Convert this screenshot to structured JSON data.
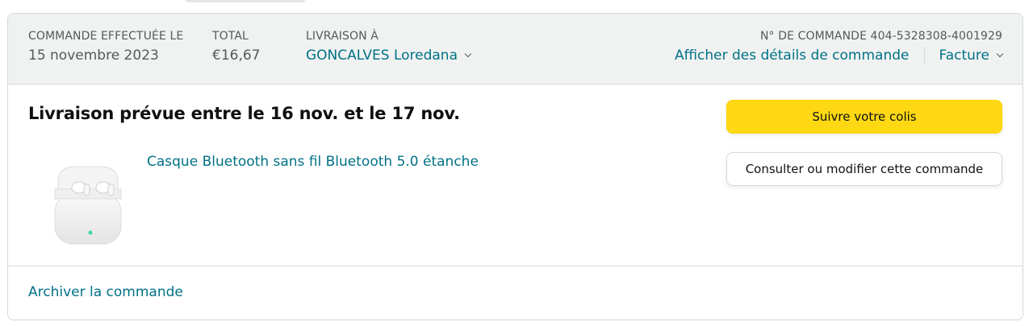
{
  "order": {
    "placed_label": "COMMANDE EFFECTUÉE LE",
    "placed_date": "15 novembre 2023",
    "total_label": "TOTAL",
    "total_value": "€16,67",
    "ship_label": "LIVRAISON À",
    "ship_name": "GONCALVES Loredana",
    "order_number_label": "N° DE COMMANDE 404-5328308-4001929",
    "details_link": "Afficher des détails de commande",
    "invoice_link": "Facture"
  },
  "delivery": {
    "title": "Livraison prévue entre le 16 nov. et le 17 nov."
  },
  "product": {
    "title": "Casque Bluetooth sans fil Bluetooth 5.0 étanche",
    "image_icon": "wireless-earbuds-case"
  },
  "actions": {
    "track_label": "Suivre votre colis",
    "modify_label": "Consulter ou modifier cette commande",
    "archive_label": "Archiver la commande"
  },
  "colors": {
    "link": "#007185",
    "primary_button": "#ffd814",
    "header_bg": "#f0f2f2",
    "border": "#d5d9d9"
  }
}
